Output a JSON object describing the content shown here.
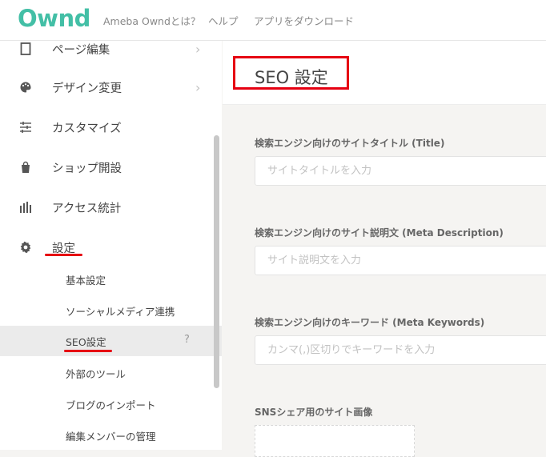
{
  "header": {
    "logo": "Ownd",
    "links": [
      "Ameba Owndとは？",
      "ヘルプ",
      "アプリをダウンロード"
    ]
  },
  "sidebar": {
    "items": [
      {
        "label": "ページ編集",
        "icon": "page-edit-icon"
      },
      {
        "label": "デザイン変更",
        "icon": "palette-icon"
      },
      {
        "label": "カスタマイズ",
        "icon": "sliders-icon"
      },
      {
        "label": "ショップ開設",
        "icon": "shopping-bag-icon"
      },
      {
        "label": "アクセス統計",
        "icon": "bar-chart-icon"
      },
      {
        "label": "設定",
        "icon": "gear-icon"
      }
    ],
    "subitems": [
      {
        "label": "基本設定"
      },
      {
        "label": "ソーシャルメディア連携"
      },
      {
        "label": "SEO設定",
        "help": "?"
      },
      {
        "label": "外部のツール"
      },
      {
        "label": "ブログのインポート"
      },
      {
        "label": "編集メンバーの管理"
      }
    ],
    "active_subitem": "SEO設定"
  },
  "main": {
    "title": "SEO 設定",
    "fields": [
      {
        "label": "検索エンジン向けのサイトタイトル (Title)",
        "placeholder": "サイトタイトルを入力",
        "value": ""
      },
      {
        "label": "検索エンジン向けのサイト説明文 (Meta Description)",
        "placeholder": "サイト説明文を入力",
        "value": ""
      },
      {
        "label": "検索エンジン向けのキーワード (Meta Keywords)",
        "placeholder": "カンマ(,)区切りでキーワードを入力",
        "value": ""
      }
    ],
    "image_label": "SNSシェア用のサイト画像"
  },
  "colors": {
    "brand": "#43bfa6",
    "annotation_red": "#e60012",
    "active_bg": "#ebebeb"
  }
}
